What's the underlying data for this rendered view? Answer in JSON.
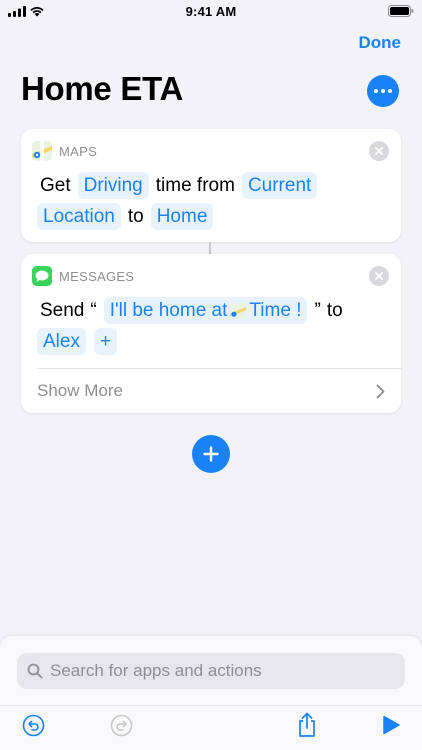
{
  "status_bar": {
    "time": "9:41 AM"
  },
  "nav": {
    "done_label": "Done"
  },
  "page": {
    "title": "Home ETA"
  },
  "actions": [
    {
      "app": "MAPS",
      "icon": "maps-app-icon",
      "words": {
        "get": "Get",
        "time_from": "time from",
        "to": "to"
      },
      "tokens": {
        "mode": "Driving",
        "from": "Current",
        "from2": "Location",
        "dest": "Home"
      }
    },
    {
      "app": "MESSAGES",
      "icon": "messages-app-icon",
      "words": {
        "send": "Send",
        "open_quote": "“",
        "close_quote": "”",
        "to": "to"
      },
      "tokens": {
        "message_text": "I'll be home at",
        "variable": "Time !",
        "recipient": "Alex",
        "add": "+"
      },
      "show_more": "Show More"
    }
  ],
  "bottom_sheet": {
    "search_placeholder": "Search for apps and actions"
  },
  "colors": {
    "accent": "#1a82f7",
    "background": "#f2f2f7",
    "card": "#ffffff",
    "token_bg": "#e8f2fd",
    "secondary_text": "#8e8e93"
  }
}
